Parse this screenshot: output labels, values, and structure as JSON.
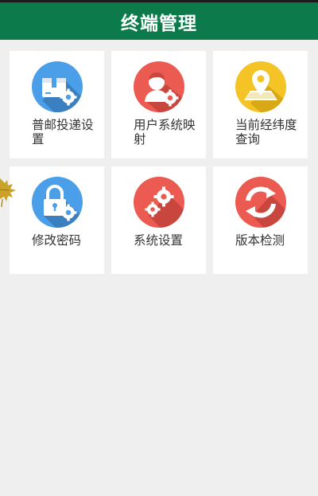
{
  "header": {
    "title": "终端管理"
  },
  "tiles": [
    {
      "label": "普邮投递设置",
      "icon": "package-gear-icon",
      "color": "#4a9fe8"
    },
    {
      "label": "用户系统映射",
      "icon": "user-gear-icon",
      "color": "#ec5b52"
    },
    {
      "label": "当前经纬度查询",
      "icon": "location-pin-icon",
      "color": "#f4c325"
    },
    {
      "label": "修改密码",
      "icon": "lock-gear-icon",
      "color": "#4a9fe8"
    },
    {
      "label": "系统设置",
      "icon": "gears-icon",
      "color": "#ec5b52"
    },
    {
      "label": "版本检测",
      "icon": "refresh-icon",
      "color": "#ec5b52"
    }
  ],
  "colors": {
    "header": "#0c7a4a",
    "background": "#efefef",
    "tile": "#ffffff"
  }
}
